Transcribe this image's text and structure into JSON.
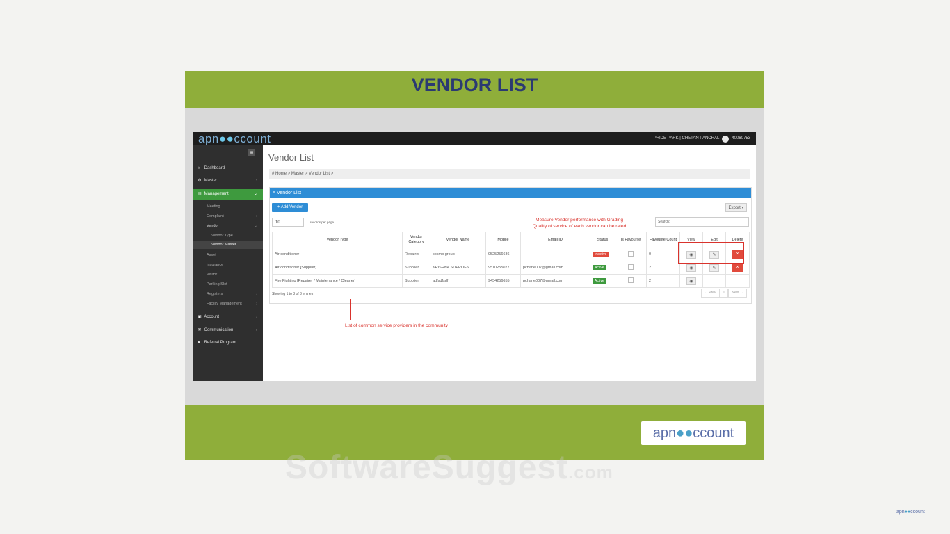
{
  "slide": {
    "title": "VENDOR LIST",
    "logo": {
      "pre": "apn",
      "mid": "●●",
      "post": "ccount"
    }
  },
  "app": {
    "brand": {
      "pre": "apn",
      "mid": "●●",
      "post": "ccount"
    },
    "user": {
      "society": "PRIDE PARK | CHETAN PANCHAL",
      "id": "40060753"
    },
    "sidebar": {
      "items": [
        {
          "label": "Dashboard",
          "icon": "home-icon"
        },
        {
          "label": "Master",
          "icon": "gears-icon"
        },
        {
          "label": "Management",
          "icon": "building-icon"
        }
      ],
      "sub_items": [
        "Meeting",
        "Complaint",
        "Vendor"
      ],
      "vendor_children": [
        "Vendor Type",
        "Vendor Master"
      ],
      "more_items": [
        "Asset",
        "Insurance",
        "Visitor",
        "Parking Slot",
        "Registers",
        "Facility Management"
      ],
      "bottom_items": [
        {
          "label": "Account",
          "icon": "money-icon"
        },
        {
          "label": "Communication",
          "icon": "chat-icon"
        },
        {
          "label": "Referral Program",
          "icon": "sitemap-icon"
        }
      ]
    },
    "page": {
      "heading": "Vendor List",
      "breadcrumb": "# Home > Master > Vendor List >"
    },
    "panel": {
      "title": "≡ Vendor List",
      "add_button": "+ Add Vendor",
      "export_button": "Export ▾",
      "page_length": "10",
      "page_length_suffix": "records per page",
      "search_placeholder": "Search:"
    },
    "table": {
      "headers": [
        "Vendor Type",
        "Vendor Category",
        "Vendor Name",
        "Mobile",
        "Email ID",
        "Status",
        "Is Favourite",
        "Favourite Count",
        "View",
        "Edit",
        "Delete"
      ],
      "rows": [
        {
          "type": "Air conditioner",
          "category": "Repairer",
          "name": "cosmo group",
          "mobile": "9525256686",
          "email": "",
          "status": "Inactive",
          "status_color": "#e14a3c",
          "fav_count": "0"
        },
        {
          "type": "Air conditioner [Supplier]",
          "category": "Supplier",
          "name": "KRISHNA SUPPLIES",
          "mobile": "9510255077",
          "email": "pchane007@gmail.com",
          "status": "Active",
          "status_color": "#3e9a3e",
          "fav_count": "2"
        },
        {
          "type": "Fire Fighting [Repairer / Maintenance / Cleaner]",
          "category": "Supplier",
          "name": "adfsdfsdf",
          "mobile": "9454256655",
          "email": "pchane007@gmail.com",
          "status": "Active",
          "status_color": "#3e9a3e",
          "fav_count": "2"
        }
      ]
    },
    "footer": {
      "showing": "Showing 1 to 3 of 3 entries",
      "prev": "← Prev",
      "page": "1",
      "next": "Next →"
    }
  },
  "annotations": {
    "grading_line1": "Measure Vendor performance with Grading",
    "grading_line2": "Quality of service of each vendor can be rated",
    "providers": "List of common service providers in the community"
  },
  "watermark": {
    "main": "SoftwareSuggest",
    "suffix": ".com"
  },
  "colors": {
    "green": "#8fae3a",
    "blue": "#2e8dd6",
    "title": "#2b3a72",
    "annotation": "#d9332d"
  }
}
